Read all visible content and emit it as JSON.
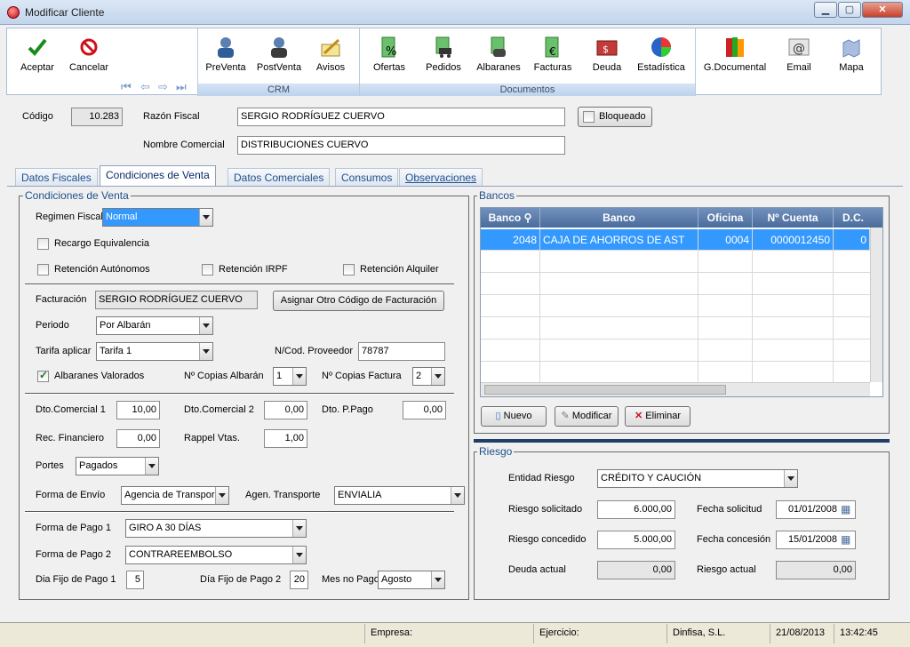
{
  "window": {
    "title": "Modificar Cliente"
  },
  "toolbar": {
    "buttons": {
      "aceptar": "Aceptar",
      "cancelar": "Cancelar",
      "preventa": "PreVenta",
      "postventa": "PostVenta",
      "avisos": "Avisos",
      "ofertas": "Ofertas",
      "pedidos": "Pedidos",
      "albaranes": "Albaranes",
      "facturas": "Facturas",
      "deuda": "Deuda",
      "estadistica": "Estadística",
      "gdocumental": "G.Documental",
      "email": "Email",
      "mapa": "Mapa"
    },
    "groups": {
      "crm": "CRM",
      "documentos": "Documentos"
    }
  },
  "header": {
    "codigo_label": "Código",
    "codigo_value": "10.283",
    "razon_label": "Razón Fiscal",
    "razon_value": "SERGIO RODRÍGUEZ CUERVO",
    "bloqueado_label": "Bloqueado",
    "nombre_label": "Nombre Comercial",
    "nombre_value": "DISTRIBUCIONES CUERVO"
  },
  "tabs": [
    "Datos Fiscales",
    "Condiciones de Venta",
    "Datos Comerciales",
    "Consumos",
    "Observaciones"
  ],
  "condiciones": {
    "title": "Condiciones de Venta",
    "regimen_label": "Regimen Fiscal",
    "regimen_value": "Normal",
    "recargo_label": "Recargo Equivalencia",
    "ret_autonomos_label": "Retención Autónomos",
    "ret_irpf_label": "Retención IRPF",
    "ret_alquiler_label": "Retención Alquiler",
    "facturacion_label": "Facturación",
    "facturacion_value": "SERGIO RODRÍGUEZ CUERVO",
    "asignar_btn": "Asignar Otro Código de Facturación",
    "periodo_label": "Periodo",
    "periodo_value": "Por Albarán",
    "tarifa_label": "Tarifa aplicar",
    "tarifa_value": "Tarifa 1",
    "ncod_label": "N/Cod. Proveedor",
    "ncod_value": "78787",
    "albaranes_val_label": "Albaranes Valorados",
    "copias_alb_label": "Nº Copias Albarán",
    "copias_alb_value": "1",
    "copias_fac_label": "Nº Copias Factura",
    "copias_fac_value": "2",
    "dto_com1_label": "Dto.Comercial 1",
    "dto_com1_value": "10,00",
    "dto_com2_label": "Dto.Comercial 2",
    "dto_com2_value": "0,00",
    "dto_ppago_label": "Dto. P.Pago",
    "dto_ppago_value": "0,00",
    "rec_fin_label": "Rec. Financiero",
    "rec_fin_value": "0,00",
    "rappel_label": "Rappel Vtas.",
    "rappel_value": "1,00",
    "portes_label": "Portes",
    "portes_value": "Pagados",
    "envio_label": "Forma de Envío",
    "envio_value": "Agencia de Transpor",
    "agen_label": "Agen. Transporte",
    "agen_value": "ENVIALIA",
    "pago1_label": "Forma de Pago 1",
    "pago1_value": "GIRO A 30 DÍAS",
    "pago2_label": "Forma de Pago 2",
    "pago2_value": "CONTRAREEMBOLSO",
    "dia1_label": "Dia Fijo de Pago 1",
    "dia1_value": "5",
    "dia2_label": "Día Fijo de Pago 2",
    "dia2_value": "20",
    "mesno_label": "Mes no Pago",
    "mesno_value": "Agosto"
  },
  "bancos": {
    "title": "Bancos",
    "columns": [
      "Banco",
      "Banco",
      "Oficina",
      "Nº Cuenta",
      "D.C."
    ],
    "rows": [
      {
        "banco_code": "2048",
        "banco_name": "CAJA DE AHORROS DE AST",
        "oficina": "0004",
        "cuenta": "0000012450",
        "dc": "0"
      }
    ],
    "nuevo_btn": "Nuevo",
    "modificar_btn": "Modificar",
    "eliminar_btn": "Eliminar"
  },
  "riesgo": {
    "title": "Riesgo",
    "entidad_label": "Entidad Riesgo",
    "entidad_value": "CRÉDITO Y CAUCIÓN",
    "solicitado_label": "Riesgo solicitado",
    "solicitado_value": "6.000,00",
    "fecha_sol_label": "Fecha solicitud",
    "fecha_sol_value": "01/01/2008",
    "concedido_label": "Riesgo concedido",
    "concedido_value": "5.000,00",
    "fecha_con_label": "Fecha concesión",
    "fecha_con_value": "15/01/2008",
    "deuda_label": "Deuda actual",
    "deuda_value": "0,00",
    "riesgo_act_label": "Riesgo actual",
    "riesgo_act_value": "0,00"
  },
  "status": {
    "empresa_label": "Empresa:",
    "ejercicio_label": "Ejercicio:",
    "company": "Dinfisa, S.L.",
    "date": "21/08/2013",
    "time": "13:42:45"
  }
}
